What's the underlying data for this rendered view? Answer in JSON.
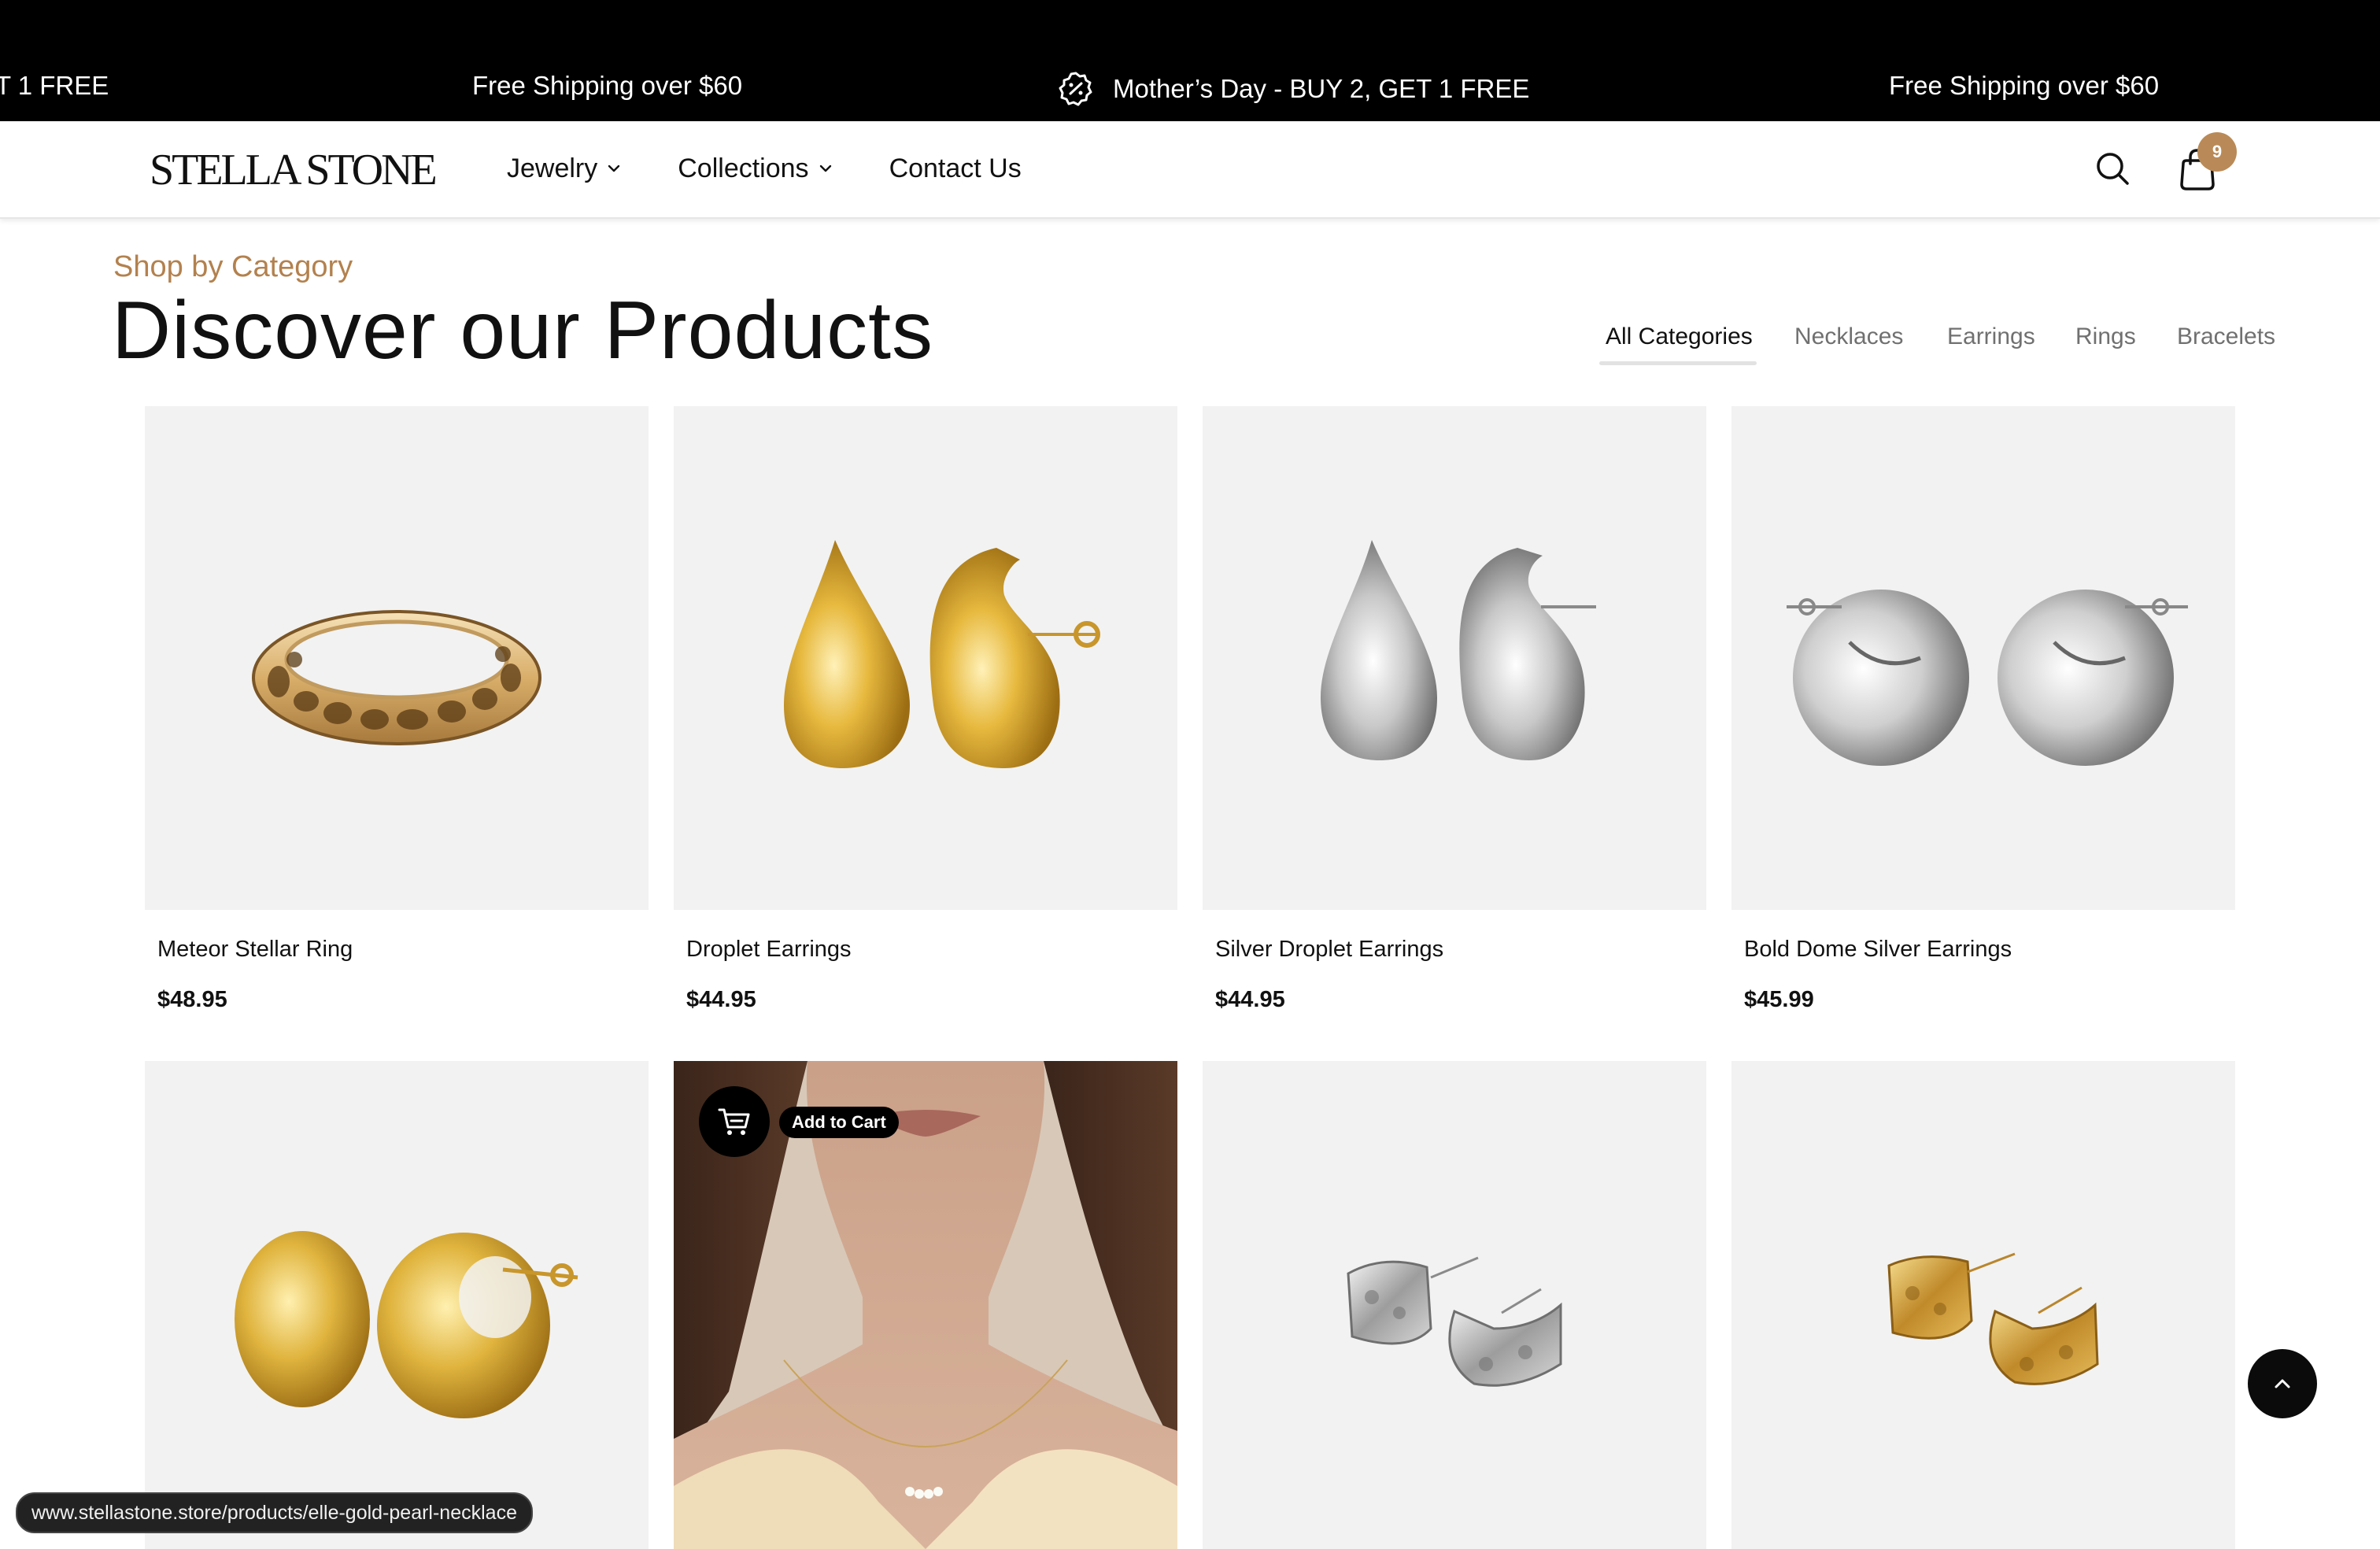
{
  "announcement": {
    "messages": [
      "T 1 FREE",
      "Free Shipping over $60",
      "Mother’s Day - BUY 2, GET 1 FREE",
      "Free Shipping over $60"
    ],
    "icon": "discount-badge-icon"
  },
  "header": {
    "logo": "STELLA STONE",
    "nav": [
      {
        "label": "Jewelry",
        "has_dropdown": true
      },
      {
        "label": "Collections",
        "has_dropdown": true
      },
      {
        "label": "Contact Us",
        "has_dropdown": false
      }
    ],
    "cart_count": "9",
    "icons": [
      "search-icon",
      "shopping-bag-icon"
    ]
  },
  "section": {
    "eyebrow": "Shop by Category",
    "title": "Discover our Products",
    "categories": [
      "All Categories",
      "Necklaces",
      "Earrings",
      "Rings",
      "Bracelets"
    ],
    "active_category": "All Categories"
  },
  "products": [
    {
      "name": "Meteor Stellar Ring",
      "price": "$48.95"
    },
    {
      "name": "Droplet Earrings",
      "price": "$44.95"
    },
    {
      "name": "Silver Droplet Earrings",
      "price": "$44.95"
    },
    {
      "name": "Bold Dome Silver Earrings",
      "price": "$45.99"
    },
    {
      "name": "",
      "price": ""
    },
    {
      "name": "",
      "price": ""
    },
    {
      "name": "",
      "price": ""
    },
    {
      "name": "",
      "price": ""
    }
  ],
  "overlay": {
    "add_to_cart": "Add to Cart"
  },
  "status_url": "www.stellastone.store/products/elle-gold-pearl-necklace",
  "colors": {
    "accent": "#b98a57",
    "eyebrow": "#b3814e",
    "card_bg": "#f2f2f2",
    "announcement_bg": "#000000"
  }
}
